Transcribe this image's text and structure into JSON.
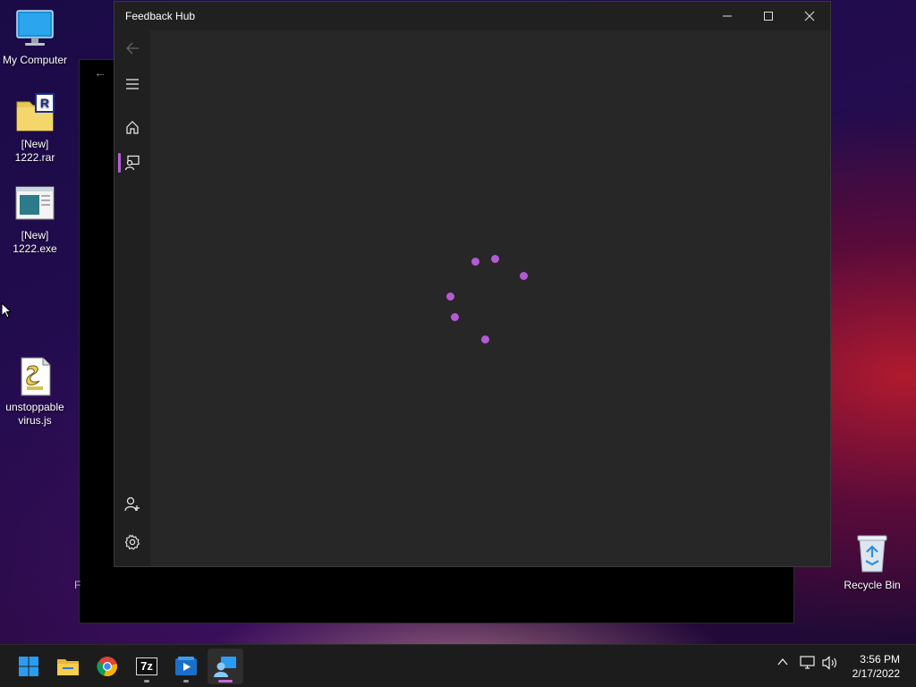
{
  "desktop": {
    "icons": [
      {
        "label": "My Computer",
        "icon": "monitor-icon"
      },
      {
        "label": "[New]\n1222.rar",
        "icon": "winrar-archive-icon"
      },
      {
        "label": "[New]\n1222.exe",
        "icon": "executable-window-icon"
      },
      {
        "label": "unstoppable\nvirus.js",
        "icon": "script-file-icon"
      }
    ],
    "recycle_bin": {
      "label": "Recycle Bin",
      "icon": "recycle-bin-icon"
    }
  },
  "background_window": {
    "back_glyph": "←",
    "fragment_text": "F"
  },
  "feedback_hub": {
    "title": "Feedback Hub",
    "controls": {
      "minimize": "minimize-icon",
      "maximize": "maximize-icon",
      "close": "close-icon"
    },
    "nav": {
      "back": "back-arrow-icon",
      "menu": "hamburger-menu-icon",
      "home": "home-icon",
      "feedback": "feedback-icon",
      "account": "add-account-icon",
      "settings": "gear-icon"
    },
    "accent_color": "#b45ad6",
    "loading": true
  },
  "taskbar": {
    "apps": [
      {
        "name": "Start",
        "icon": "windows-start-icon",
        "active": false
      },
      {
        "name": "File Explorer",
        "icon": "folder-icon",
        "active": false
      },
      {
        "name": "Google Chrome",
        "icon": "chrome-icon",
        "active": false
      },
      {
        "name": "7-Zip",
        "icon": "sevenzip-icon",
        "label": "7z",
        "active": false
      },
      {
        "name": "Media Player",
        "icon": "media-player-icon",
        "active": false
      },
      {
        "name": "Feedback Hub",
        "icon": "feedback-hub-icon",
        "active": true
      }
    ],
    "tray": {
      "chevron": "chevron-up-icon",
      "network": "network-icon",
      "volume": "speaker-icon"
    },
    "clock": {
      "time": "3:56 PM",
      "date": "2/17/2022"
    }
  }
}
